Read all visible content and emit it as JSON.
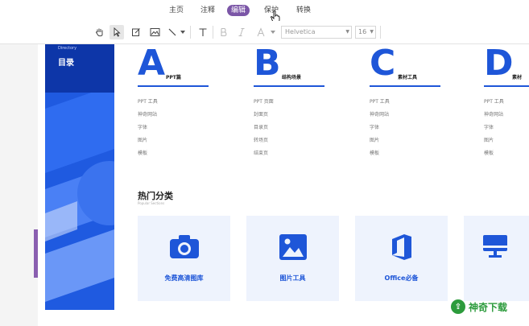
{
  "menu": {
    "items": [
      {
        "label": "主页",
        "active": false
      },
      {
        "label": "注释",
        "active": false
      },
      {
        "label": "编辑",
        "active": true
      },
      {
        "label": "保护",
        "active": false
      },
      {
        "label": "转换",
        "active": false
      }
    ]
  },
  "toolbar": {
    "font_name": "Helvetica",
    "font_size": "16"
  },
  "banner": {
    "small": "Directory",
    "title": "目录"
  },
  "sections": [
    {
      "letter": "A",
      "label": "PPT篇",
      "items": [
        "PPT 工具",
        "神奇网站",
        "字体",
        "图片",
        "模板"
      ]
    },
    {
      "letter": "B",
      "label": "结构场景",
      "items": [
        "PPT 页面",
        "封面页",
        "目录页",
        "转场页",
        "结束页"
      ]
    },
    {
      "letter": "C",
      "label": "素材工具",
      "items": [
        "PPT 工具",
        "神奇网站",
        "字体",
        "图片",
        "模板"
      ]
    },
    {
      "letter": "D",
      "label": "素材",
      "items": [
        "PPT 工具",
        "神奇网站",
        "字体",
        "图片",
        "模板"
      ]
    }
  ],
  "hot": {
    "title": "热门分类",
    "subtitle": "Popular Sections"
  },
  "cards": [
    {
      "label": "免费高清图库",
      "icon": "camera-icon"
    },
    {
      "label": "图片工具",
      "icon": "image-icon"
    },
    {
      "label": "Office必备",
      "icon": "office-icon"
    },
    {
      "label": "",
      "icon": "monitor-icon"
    }
  ],
  "watermark": {
    "text": "神奇下载",
    "logo_char": "⇪"
  },
  "colors": {
    "accent": "#7b56a7",
    "brand_blue": "#1e56d8",
    "watermark_green": "#2c9b3c"
  }
}
